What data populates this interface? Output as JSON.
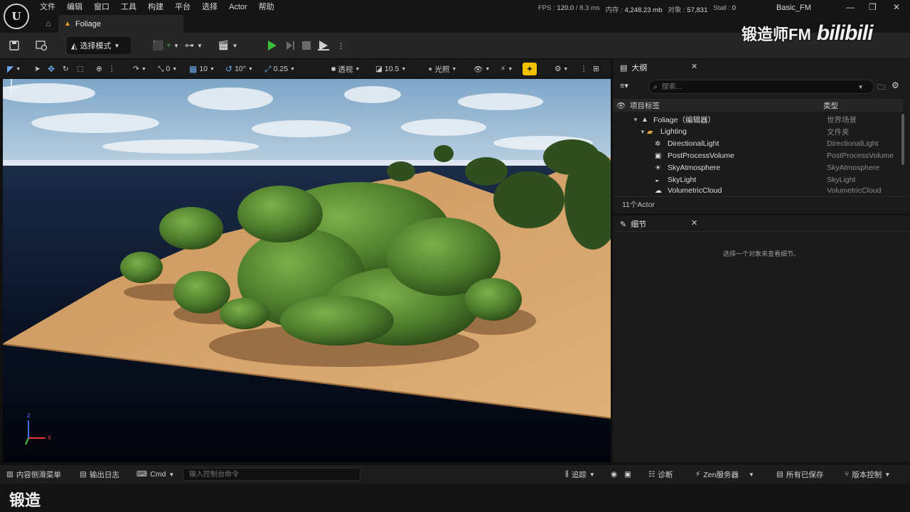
{
  "menu": {
    "items": [
      "文件",
      "编辑",
      "窗口",
      "工具",
      "构建",
      "平台",
      "选择",
      "Actor",
      "帮助"
    ],
    "logo": "U"
  },
  "level_tab": {
    "label": "Foliage"
  },
  "stats": {
    "fps_label": "FPS :",
    "fps": "120.0",
    "ms": "/ 8.3 ms",
    "mem_label": "内存 :",
    "mem": "4,248.23 mb",
    "obj_label": "对象 :",
    "obj": "57,831",
    "stall_label": "Stall :",
    "stall": "0"
  },
  "project_name": "Basic_FM",
  "toolbar": {
    "mode_label": "选择模式"
  },
  "watermark": {
    "text": "锻造师FM",
    "brand": "bilibili"
  },
  "viewport_toolbar": {
    "rotate_snap_value": "0",
    "scale_value": "0",
    "grid_snap": "10",
    "angle_snap": "10°",
    "scale_snap": "0.25",
    "view_mode": "透视",
    "camera_speed": "10.5",
    "lighting": "光照"
  },
  "viewport": {
    "axis_x": "x",
    "axis_z": "z"
  },
  "outliner": {
    "tab_label": "大纲",
    "search_placeholder": "搜索...",
    "col_label": "项目标签",
    "col_type": "类型",
    "rows": [
      {
        "label": "Foliage（编辑器）",
        "type": "世界场景"
      },
      {
        "label": "Lighting",
        "type": "文件夹"
      },
      {
        "label": "DirectionalLight",
        "type": "DirectionalLight"
      },
      {
        "label": "PostProcessVolume",
        "type": "PostProcessVolume"
      },
      {
        "label": "SkyAtmosphere",
        "type": "SkyAtmosphere"
      },
      {
        "label": "SkyLight",
        "type": "SkyLight"
      },
      {
        "label": "VolumetricCloud",
        "type": "VolumetricCloud"
      }
    ],
    "actor_count": "11个Actor"
  },
  "details": {
    "tab_label": "细节",
    "empty_message": "选择一个对象来查看细节。"
  },
  "bottombar": {
    "content_drawer": "内容侧滑菜单",
    "output_log": "输出日志",
    "cmd_label": "Cmd",
    "cmd_placeholder": "输入控制台命令",
    "trace": "追踪",
    "diagnostics": "诊断",
    "zen": "Zen服务器",
    "saved": "所有已保存",
    "source_control": "版本控制"
  },
  "subtitle": "锻造",
  "colors": {
    "accent_yellow": "#f2c200",
    "play_green": "#3bbf3b",
    "folder": "#d9a441"
  }
}
